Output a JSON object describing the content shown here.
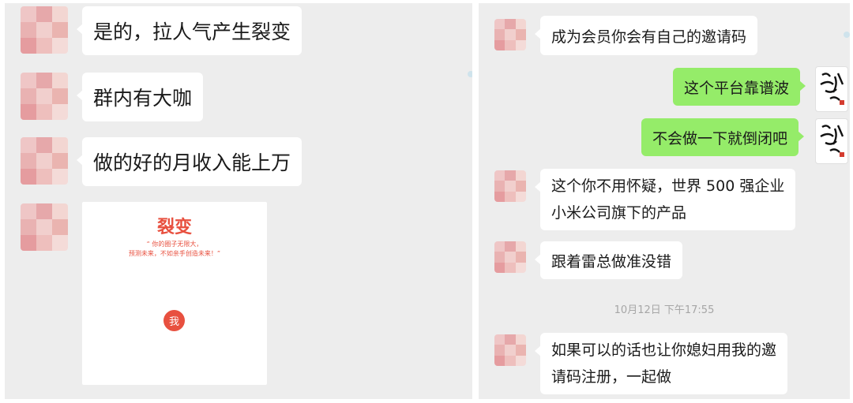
{
  "left": {
    "messages": [
      {
        "text": "是的，拉人气产生裂变"
      },
      {
        "text": "群内有大咖"
      },
      {
        "text": "做的好的月收入能上万"
      }
    ],
    "poster": {
      "title": "裂变",
      "quote_line1": "“ 你的圈子无限大，",
      "quote_line2": "预测未来，不如亲手创造未来！”",
      "badge": "我"
    }
  },
  "right": {
    "messages": [
      {
        "text": "成为会员你会有自己的邀请码"
      },
      {
        "text": "这个平台靠谱波"
      },
      {
        "text": "不会做一下就倒闭吧"
      },
      {
        "line1": "这个你不用怀疑，世界 500 强企业",
        "line2": "小米公司旗下的产品"
      },
      {
        "text": "跟着雷总做准没错"
      },
      {
        "line1": "如果可以的话也让你媳妇用我的邀",
        "line2": "请码注册，一起做"
      }
    ],
    "timestamp": "10月12日 下午17:55"
  },
  "colors": {
    "chat_bg": "#ededed",
    "bubble_received": "#ffffff",
    "bubble_sent": "#95ec69",
    "poster_accent": "#e8503f"
  }
}
